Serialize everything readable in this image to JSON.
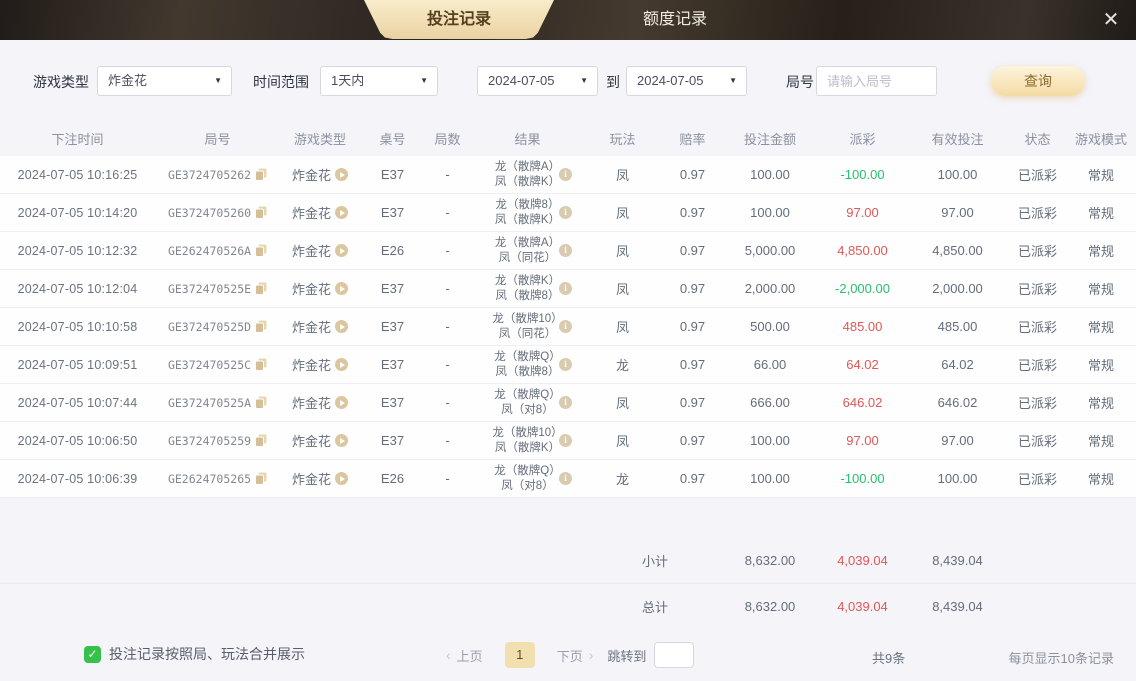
{
  "tabs": {
    "active": "投注记录",
    "inactive": "额度记录"
  },
  "icons": {
    "close": "✕",
    "caret": "▼",
    "prev": "‹",
    "next": "›",
    "check": "✓",
    "info": "i"
  },
  "colors": {
    "accent_tan": "#f2dfb0",
    "gain_red": "#e25757",
    "loss_green": "#2abf6e",
    "checkbox_green": "#36c24a"
  },
  "filters": {
    "game_type_label": "游戏类型",
    "game_type_value": "炸金花",
    "time_range_label": "时间范围",
    "time_range_value": "1天内",
    "date_from": "2024-07-05",
    "to_label": "到",
    "date_to": "2024-07-05",
    "round_label": "局号",
    "round_placeholder": "请输入局号",
    "search_button": "查询"
  },
  "table": {
    "headers": [
      "下注时间",
      "局号",
      "游戏类型",
      "桌号",
      "局数",
      "结果",
      "玩法",
      "赔率",
      "投注金额",
      "派彩",
      "有效投注",
      "状态",
      "游戏模式"
    ],
    "rows": [
      {
        "time": "2024-07-05 10:16:25",
        "round_id": "GE3724705262",
        "game": "炸金花",
        "table_no": "E37",
        "rounds": "-",
        "result_line1": "龙（散牌A）",
        "result_line2": "凤（散牌K）",
        "play": "凤",
        "odds": "0.97",
        "bet": "100.00",
        "payout": "-100.00",
        "valid": "100.00",
        "status": "已派彩",
        "mode": "常规"
      },
      {
        "time": "2024-07-05 10:14:20",
        "round_id": "GE3724705260",
        "game": "炸金花",
        "table_no": "E37",
        "rounds": "-",
        "result_line1": "龙（散牌8）",
        "result_line2": "凤（散牌K）",
        "play": "凤",
        "odds": "0.97",
        "bet": "100.00",
        "payout": "97.00",
        "valid": "97.00",
        "status": "已派彩",
        "mode": "常规"
      },
      {
        "time": "2024-07-05 10:12:32",
        "round_id": "GE262470526A",
        "game": "炸金花",
        "table_no": "E26",
        "rounds": "-",
        "result_line1": "龙（散牌A）",
        "result_line2": "凤（同花）",
        "play": "凤",
        "odds": "0.97",
        "bet": "5,000.00",
        "payout": "4,850.00",
        "valid": "4,850.00",
        "status": "已派彩",
        "mode": "常规"
      },
      {
        "time": "2024-07-05 10:12:04",
        "round_id": "GE372470525E",
        "game": "炸金花",
        "table_no": "E37",
        "rounds": "-",
        "result_line1": "龙（散牌K）",
        "result_line2": "凤（散牌8）",
        "play": "凤",
        "odds": "0.97",
        "bet": "2,000.00",
        "payout": "-2,000.00",
        "valid": "2,000.00",
        "status": "已派彩",
        "mode": "常规"
      },
      {
        "time": "2024-07-05 10:10:58",
        "round_id": "GE372470525D",
        "game": "炸金花",
        "table_no": "E37",
        "rounds": "-",
        "result_line1": "龙（散牌10）",
        "result_line2": "凤（同花）",
        "play": "凤",
        "odds": "0.97",
        "bet": "500.00",
        "payout": "485.00",
        "valid": "485.00",
        "status": "已派彩",
        "mode": "常规"
      },
      {
        "time": "2024-07-05 10:09:51",
        "round_id": "GE372470525C",
        "game": "炸金花",
        "table_no": "E37",
        "rounds": "-",
        "result_line1": "龙（散牌Q）",
        "result_line2": "凤（散牌8）",
        "play": "龙",
        "odds": "0.97",
        "bet": "66.00",
        "payout": "64.02",
        "valid": "64.02",
        "status": "已派彩",
        "mode": "常规"
      },
      {
        "time": "2024-07-05 10:07:44",
        "round_id": "GE372470525A",
        "game": "炸金花",
        "table_no": "E37",
        "rounds": "-",
        "result_line1": "龙（散牌Q）",
        "result_line2": "凤（对8）",
        "play": "凤",
        "odds": "0.97",
        "bet": "666.00",
        "payout": "646.02",
        "valid": "646.02",
        "status": "已派彩",
        "mode": "常规"
      },
      {
        "time": "2024-07-05 10:06:50",
        "round_id": "GE3724705259",
        "game": "炸金花",
        "table_no": "E37",
        "rounds": "-",
        "result_line1": "龙（散牌10）",
        "result_line2": "凤（散牌K）",
        "play": "凤",
        "odds": "0.97",
        "bet": "100.00",
        "payout": "97.00",
        "valid": "97.00",
        "status": "已派彩",
        "mode": "常规"
      },
      {
        "time": "2024-07-05 10:06:39",
        "round_id": "GE2624705265",
        "game": "炸金花",
        "table_no": "E26",
        "rounds": "-",
        "result_line1": "龙（散牌Q）",
        "result_line2": "凤（对8）",
        "play": "龙",
        "odds": "0.97",
        "bet": "100.00",
        "payout": "-100.00",
        "valid": "100.00",
        "status": "已派彩",
        "mode": "常规"
      }
    ],
    "subtotal": {
      "label": "小计",
      "bet": "8,632.00",
      "payout": "4,039.04",
      "valid": "8,439.04"
    },
    "total": {
      "label": "总计",
      "bet": "8,632.00",
      "payout": "4,039.04",
      "valid": "8,439.04"
    }
  },
  "footer": {
    "merge_checkbox_label": "投注记录按照局、玩法合并展示",
    "prev_label": "上页",
    "current_page": "1",
    "next_label": "下页",
    "jump_label": "跳转到",
    "total_count": "共9条",
    "page_size_text": "每页显示10条记录"
  }
}
